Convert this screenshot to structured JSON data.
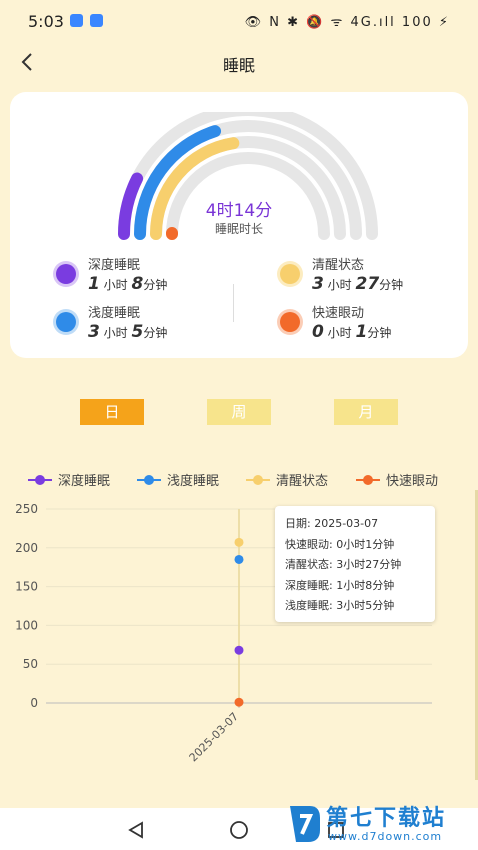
{
  "status_bar": {
    "time": "5:03",
    "right_text": "👁 N ✱ 🔕 ᯤ 4G.ıll 100 ⚡"
  },
  "header": {
    "title": "睡眠"
  },
  "summary": {
    "total": "4时14分",
    "total_label": "睡眠时长",
    "items": [
      {
        "name": "深度睡眠",
        "h": "1",
        "h_unit": " 小时 ",
        "m": "8",
        "m_unit": "分钟",
        "color": "#7a3ce0"
      },
      {
        "name": "浅度睡眠",
        "h": "3",
        "h_unit": " 小时 ",
        "m": "5",
        "m_unit": "分钟",
        "color": "#2f8be8"
      },
      {
        "name": "清醒状态",
        "h": "3",
        "h_unit": " 小时 ",
        "m": "27",
        "m_unit": "分钟",
        "color": "#f7cf6d"
      },
      {
        "name": "快速眼动",
        "h": "0",
        "h_unit": " 小时 ",
        "m": "1",
        "m_unit": "分钟",
        "color": "#f26a2a"
      }
    ]
  },
  "range_tabs": [
    {
      "label": "日",
      "active": true
    },
    {
      "label": "周",
      "active": false
    },
    {
      "label": "月",
      "active": false
    }
  ],
  "colors": {
    "deep": "#7a3ce0",
    "light": "#2f8be8",
    "awake": "#f7cf6d",
    "rem": "#f26a2a",
    "tab_active": "#f5a31a",
    "tab_inactive": "#f7e48c",
    "arc_bg": "#e6e6e6"
  },
  "chart_data": {
    "type": "scatter",
    "categories": [
      "2025-03-07"
    ],
    "series": [
      {
        "name": "深度睡眠",
        "values": [
          68
        ]
      },
      {
        "name": "浅度睡眠",
        "values": [
          185
        ]
      },
      {
        "name": "清醒状态",
        "values": [
          207
        ]
      },
      {
        "name": "快速眼动",
        "values": [
          1
        ]
      }
    ],
    "ylim": [
      0,
      250
    ],
    "yticks": [
      0,
      50,
      100,
      150,
      200,
      250
    ],
    "legend": "top"
  },
  "tooltip": {
    "date": "日期: 2025-03-07",
    "rem": "快速眼动: 0小时1分钟",
    "awake": "清醒状态: 3小时27分钟",
    "deep": "深度睡眠: 1小时8分钟",
    "light": "浅度睡眠: 3小时5分钟"
  },
  "nav": {
    "back_icon": "triangle-back-icon",
    "home_icon": "circle-home-icon",
    "recent_icon": "square-recent-icon"
  },
  "watermark": {
    "title": "第七下载站",
    "url": "www.d7down.com"
  }
}
